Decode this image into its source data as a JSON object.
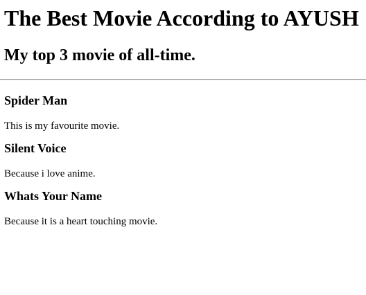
{
  "page": {
    "title": "The Best Movie According to AYUSH",
    "subtitle": "My top 3 movie of all-time."
  },
  "movies": [
    {
      "name": "Spider Man",
      "reason": "This is my favourite movie."
    },
    {
      "name": "Silent Voice",
      "reason": "Because i love anime."
    },
    {
      "name": "Whats Your Name",
      "reason": "Because it is a heart touching movie."
    }
  ]
}
